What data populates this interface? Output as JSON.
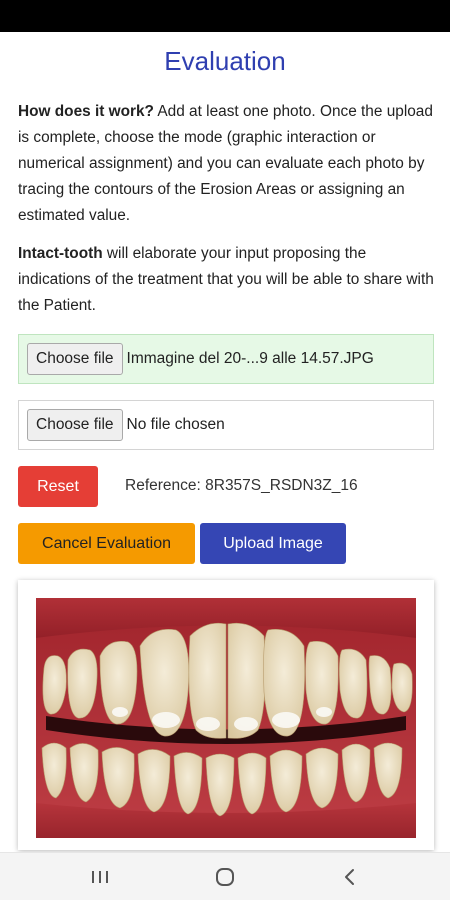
{
  "page": {
    "title": "Evaluation"
  },
  "intro": {
    "p1_bold": "How does it work?",
    "p1_text": " Add at least one photo. Once the upload is complete, choose the mode (graphic interaction or numerical assignment) and you can evaluate each photo by tracing the contours of the Erosion Areas or assigning an estimated value.",
    "p2_bold": "Intact-tooth",
    "p2_text": " will elaborate your input proposing the indications of the treatment that you will be able to share with the Patient."
  },
  "files": [
    {
      "button_label": "Choose file",
      "file_name": "Immagine del 20-...9 alle 14.57.JPG"
    },
    {
      "button_label": "Choose file",
      "file_name": "No file chosen"
    }
  ],
  "actions": {
    "reset_label": "Reset",
    "reference_text": "Reference: 8R357S_RSDN3Z_16",
    "cancel_label": "Cancel Evaluation",
    "upload_label": "Upload Image"
  },
  "colors": {
    "title": "#2f3fb0",
    "reset": "#e53e36",
    "cancel": "#f59a00",
    "upload": "#3546b4",
    "uploaded_bg": "#e6f9e6"
  },
  "icons": {
    "nav_recent": "recent-apps-icon",
    "nav_home": "home-icon",
    "nav_back": "back-icon"
  }
}
